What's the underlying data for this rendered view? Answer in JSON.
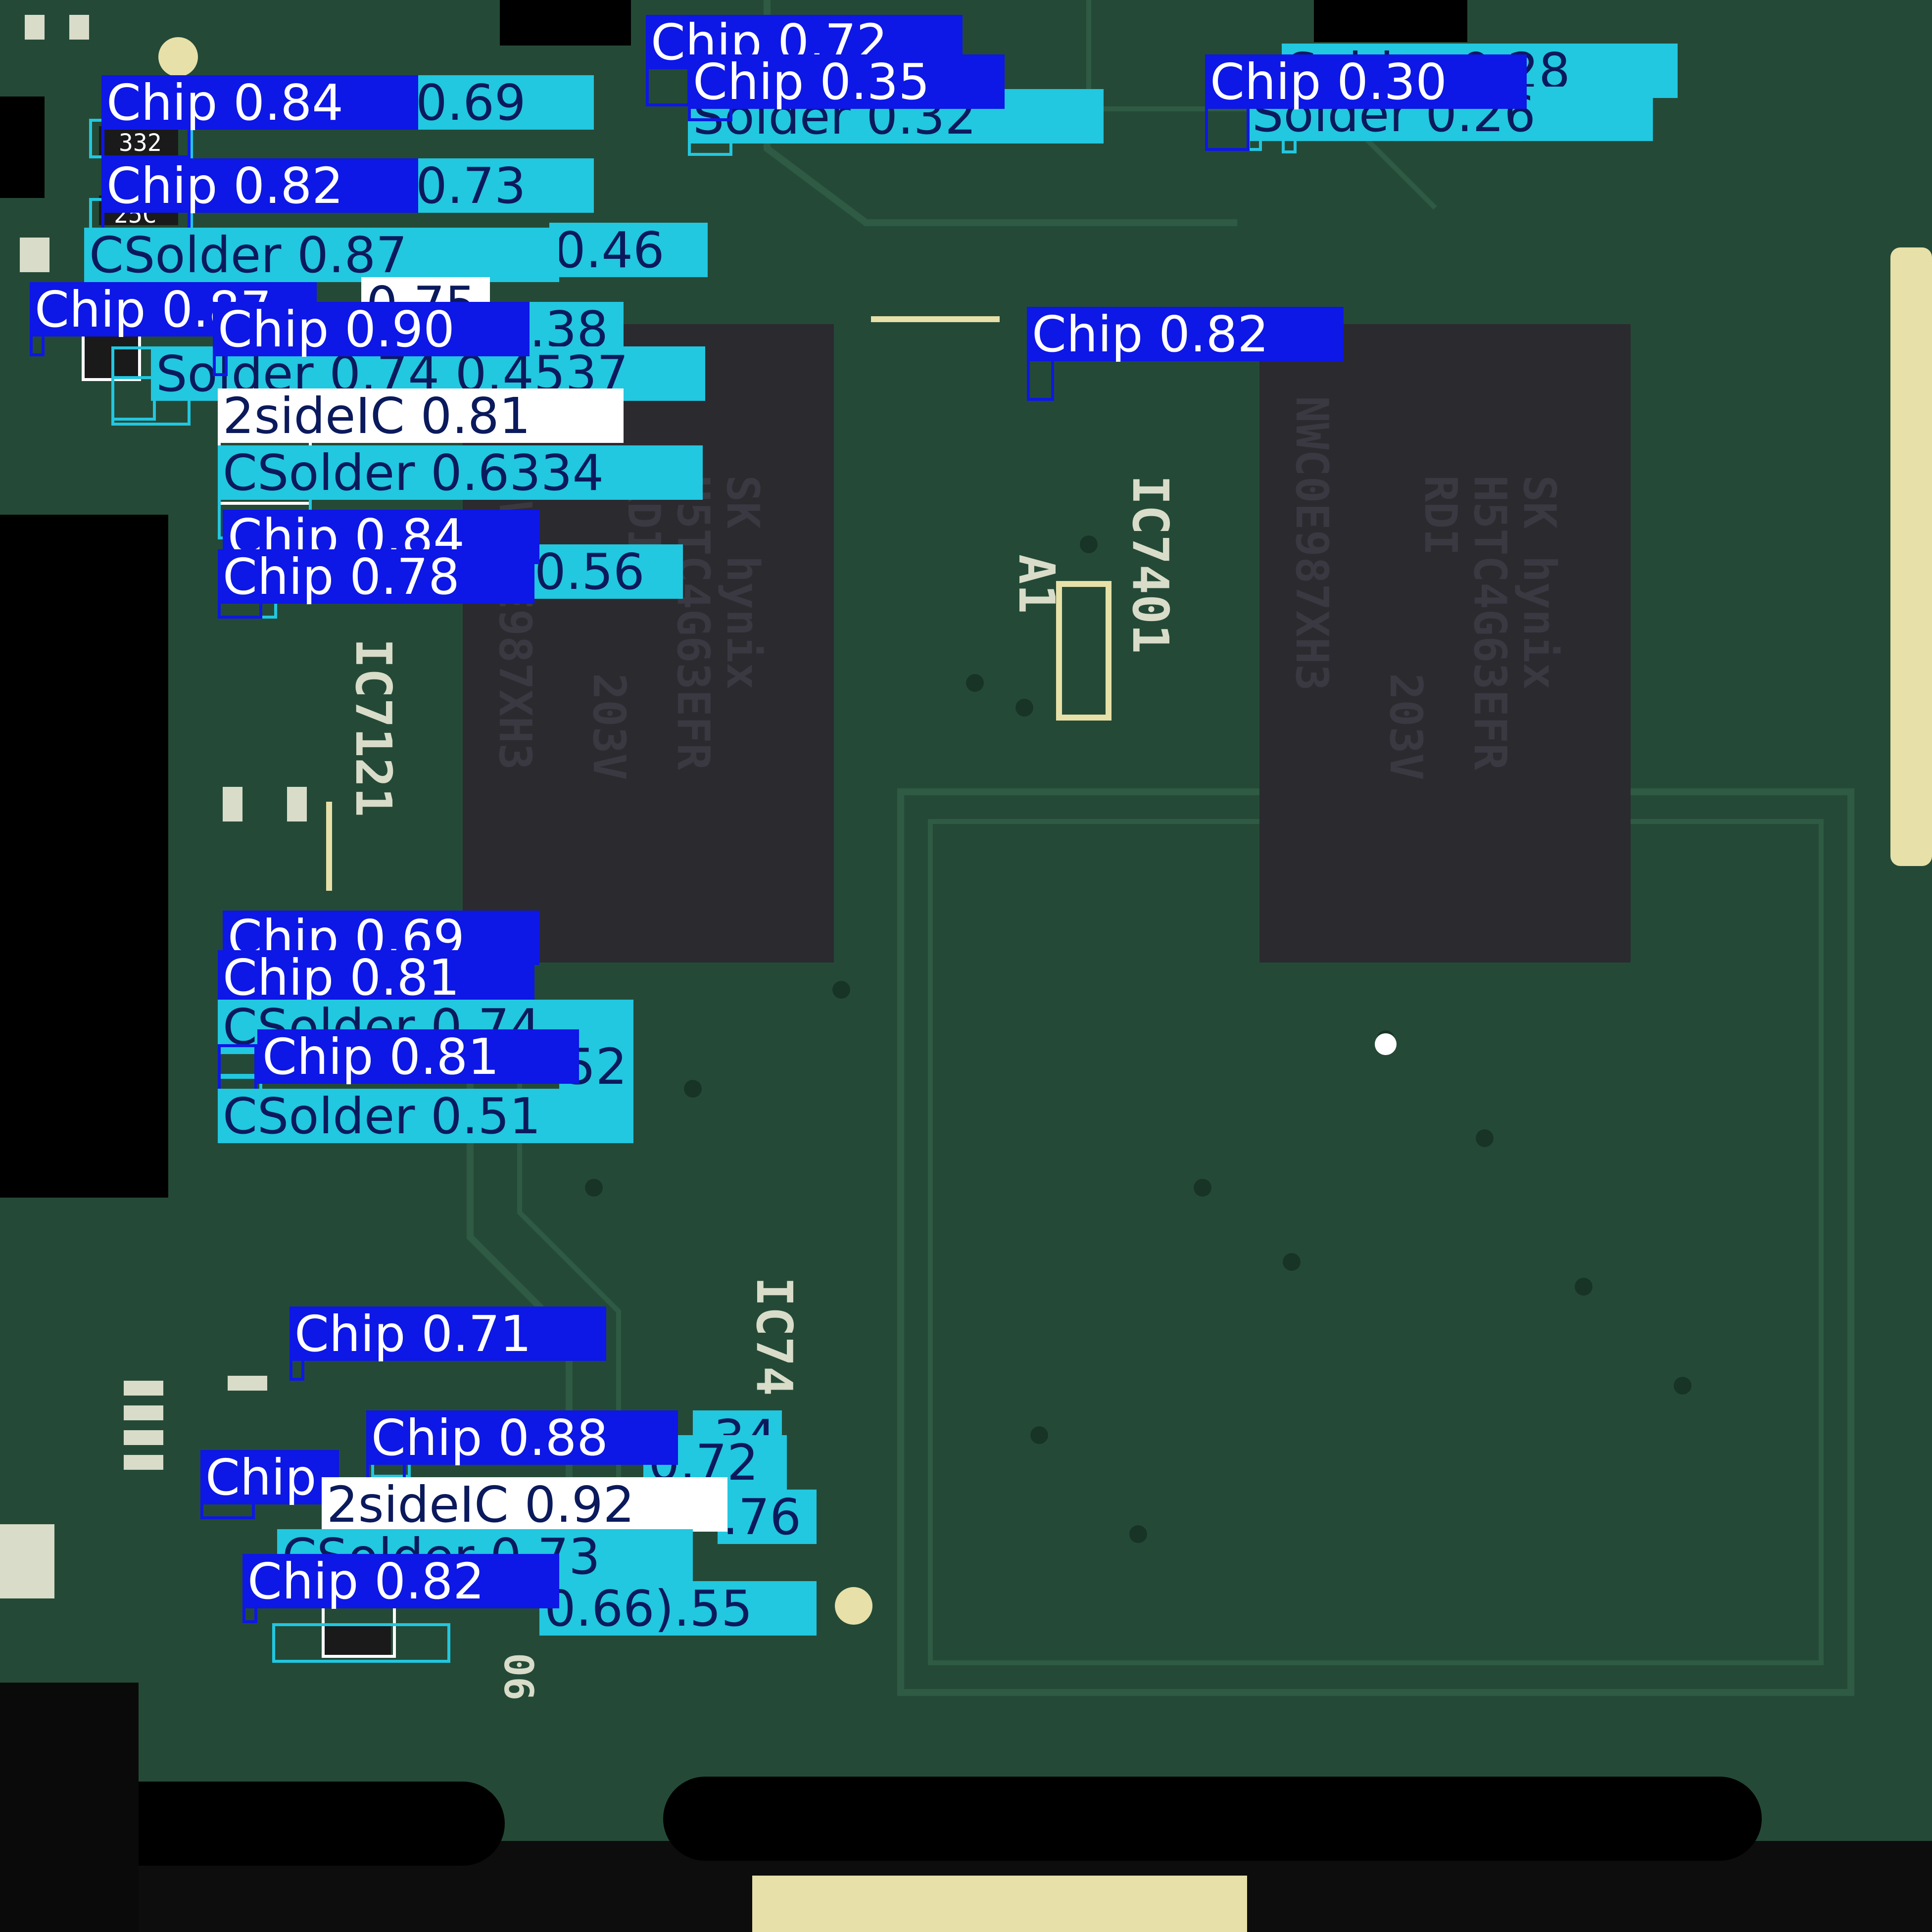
{
  "image": {
    "description_free": true,
    "colors": {
      "board": "#244a37",
      "board_dark": "#1d3a2c",
      "trace": "#2f5a43",
      "via": "#183426",
      "memory_chip": "#2b2a2f",
      "chip_text": "#3a3942",
      "silk": "#d8dcc8",
      "gold": "#e7e0a8",
      "mask": "#000000"
    }
  },
  "silkscreen": {
    "ic7121": "IC7121",
    "ic7401": "IC7401",
    "a1": "A1",
    "ic74_partial": "IC74",
    "small_06": "06",
    "r332": "332",
    "r25c": "25C"
  },
  "memory_chips": [
    {
      "maker": "SK hynix",
      "part": "H5TC4G63EFR",
      "line3": "RDI",
      "line4": "203V",
      "line5": "NWC0E987XH3"
    },
    {
      "maker": "SK hynix",
      "part": "H5TC4G63EFR",
      "line3": "RDI",
      "line4": "203V",
      "line5": "NWC0E987XH3"
    }
  ],
  "class_colors": {
    "Chip": "#0d17e6",
    "Solder": "#22c7e0",
    "2sideIC": "#ffffff",
    "Chip_text": "#ffffff",
    "Solder_text": "#0b1a5c",
    "2sideIC_text": "#0b1a5c"
  },
  "detections": [
    {
      "cls": "Solder",
      "text": "Solder 0.28",
      "score": 0.28
    },
    {
      "cls": "Solder",
      "text": "Solder 0.26",
      "score": 0.26
    },
    {
      "cls": "Chip",
      "text": "Chip 0.30",
      "score": 0.3
    },
    {
      "cls": "Solder",
      "text": "Solder 0.32",
      "score": 0.32
    },
    {
      "cls": "Chip",
      "text": "Chip 0.72",
      "score": 0.72
    },
    {
      "cls": "Chip",
      "text": "Chip 0.35",
      "score": 0.35
    },
    {
      "cls": "Solder",
      "text": "0.69",
      "score": 0.69
    },
    {
      "cls": "Chip",
      "text": "Chip 0.84",
      "score": 0.84
    },
    {
      "cls": "Solder",
      "text": "0.73",
      "score": 0.73
    },
    {
      "cls": "Chip",
      "text": "Chip 0.82",
      "score": 0.82
    },
    {
      "cls": "Solder",
      "text": "0.46",
      "score": 0.46
    },
    {
      "cls": "Solder",
      "text": "CSolder 0.87",
      "score": 0.87
    },
    {
      "cls": "2sideIC",
      "text": "0.75",
      "score": 0.75
    },
    {
      "cls": "Chip",
      "text": "Chip 0.87",
      "score": 0.87
    },
    {
      "cls": "Solder",
      "text": ".38",
      "score": 0.38
    },
    {
      "cls": "Solder",
      "text": "Solder 0.74 0.4537",
      "score": 0.74
    },
    {
      "cls": "Chip",
      "text": "Chip 0.90",
      "score": 0.9
    },
    {
      "cls": "2sideIC",
      "text": "2sideIC 0.81",
      "score": 0.81
    },
    {
      "cls": "Solder",
      "text": "CSolder 0.6334",
      "score": 0.63
    },
    {
      "cls": "Solder",
      "text": "0.56",
      "score": 0.56
    },
    {
      "cls": "Chip",
      "text": "Chip 0.84",
      "score": 0.84
    },
    {
      "cls": "Chip",
      "text": "Chip 0.78",
      "score": 0.78
    },
    {
      "cls": "Chip",
      "text": "Chip 0.82",
      "score": 0.82
    },
    {
      "cls": "Chip",
      "text": "Chip 0.69",
      "score": 0.69
    },
    {
      "cls": "Chip",
      "text": "Chip 0.81",
      "score": 0.81
    },
    {
      "cls": "Solder",
      "text": "CSolder 0.74",
      "score": 0.74
    },
    {
      "cls": "Solder",
      "text": "52",
      "score": 0.52
    },
    {
      "cls": "Chip",
      "text": "Chip 0.81",
      "score": 0.81
    },
    {
      "cls": "Solder",
      "text": "CSolder 0.51",
      "score": 0.51
    },
    {
      "cls": "Chip",
      "text": "Chip 0.71",
      "score": 0.71
    },
    {
      "cls": "Solder",
      "text": ".34",
      "score": 0.34
    },
    {
      "cls": "Solder",
      "text": "0.72",
      "score": 0.72
    },
    {
      "cls": "Chip",
      "text": "Chip 0.88",
      "score": 0.88
    },
    {
      "cls": "Solder",
      "text": ".76",
      "score": 0.76
    },
    {
      "cls": "Chip",
      "text": "Chip",
      "score": null
    },
    {
      "cls": "2sideIC",
      "text": "2sideIC 0.92",
      "score": 0.92
    },
    {
      "cls": "Solder",
      "text": "CSolder 0.73",
      "score": 0.73
    },
    {
      "cls": "Solder",
      "text": "0.66).55",
      "score": 0.66
    },
    {
      "cls": "Chip",
      "text": "Chip 0.82",
      "score": 0.82
    }
  ]
}
